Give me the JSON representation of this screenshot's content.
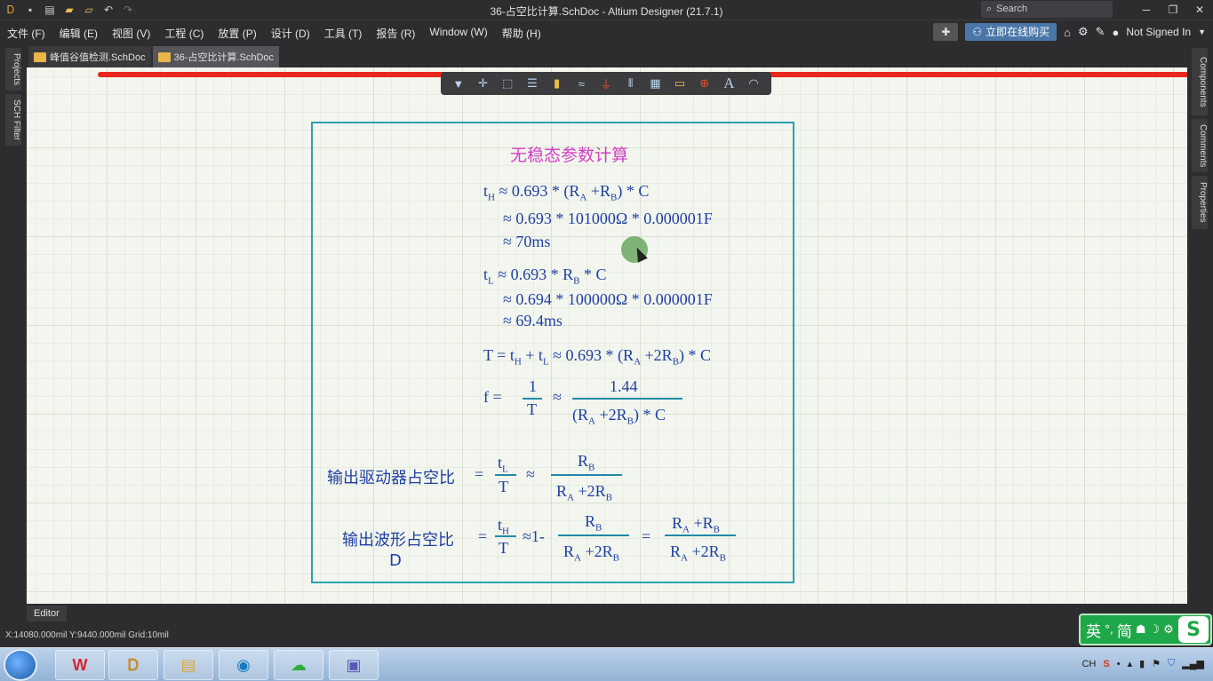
{
  "titlebar": {
    "title": "36-占空比计算.SchDoc - Altium Designer (21.7.1)",
    "search_placeholder": "Search"
  },
  "menubar": {
    "items": [
      "文件 (F)",
      "编辑 (E)",
      "视图 (V)",
      "工程 (C)",
      "放置 (P)",
      "设计 (D)",
      "工具 (T)",
      "报告 (R)",
      "Window (W)",
      "帮助 (H)"
    ],
    "buy_label": "立即在线购买",
    "user_label": "Not Signed In"
  },
  "left_panels": [
    "Projects",
    "SCH Filter"
  ],
  "right_panels": [
    "Components",
    "Comments",
    "Properties"
  ],
  "doc_tabs": [
    "峰值谷值检测.SchDoc",
    "36-占空比计算.SchDoc"
  ],
  "formula": {
    "heading": "无稳态参数计算",
    "th1": "t",
    "th1_sub": "H",
    "th1_rest": " ≈  0.693 * (R",
    "th1_a": "A",
    "th1_plus": " +R",
    "th1_b": "B",
    "th1_end": ") * C",
    "th2": "≈ 0.693 * 101000Ω *  0.000001F",
    "th3": "≈  70ms",
    "tl1": "t",
    "tl1_sub": "L",
    "tl1_rest": " ≈  0.693 * R",
    "tl1_b": "B",
    "tl1_end": " * C",
    "tl2": "≈  0.694 * 100000Ω * 0.000001F",
    "tl3": "≈  69.4ms",
    "T_line": "T  =  t",
    "T_sub_h": "H",
    "T_plus": " +  t",
    "T_sub_l": "L",
    "T_rest": "  ≈  0.693 * (R",
    "T_a": "A",
    "T_2rb": " +2R",
    "T_b": "B",
    "T_end": ") * C",
    "f_label": "f  =",
    "f_num": "1",
    "f_den": "T",
    "f_approx": "≈",
    "f_num2": "1.44",
    "f_den2": "(R",
    "f_den2_a": "A",
    "f_den2_mid": " +2R",
    "f_den2_b": "B",
    "f_den2_end": ") * C",
    "duty_driver_label": "输出驱动器占空比",
    "eq": "=",
    "approx": "≈",
    "duty_driver_num": "t",
    "duty_driver_num_sub": "L",
    "duty_driver_den": "T",
    "rb": "R",
    "rb_sub": "B",
    "ra2rb": "R",
    "ra2rb_a": "A",
    "ra2rb_mid": " +2R",
    "ra2rb_b": "B",
    "duty_wave_label": "输出波形占空比",
    "duty_wave_d": "D",
    "duty_wave_num": "t",
    "duty_wave_num_sub": "H",
    "duty_wave_den": "T",
    "approx_one": "≈1-",
    "rarb": "R",
    "rarb_a": "A",
    "rarb_mid": " +R",
    "rarb_b": "B"
  },
  "editor_tab": "Editor",
  "status": "X:14080.000mil Y:9440.000mil   Grid:10mil",
  "ime": {
    "lang": "英",
    "mode": "简",
    "logo": "S"
  },
  "tray": {
    "lang": "CH"
  }
}
